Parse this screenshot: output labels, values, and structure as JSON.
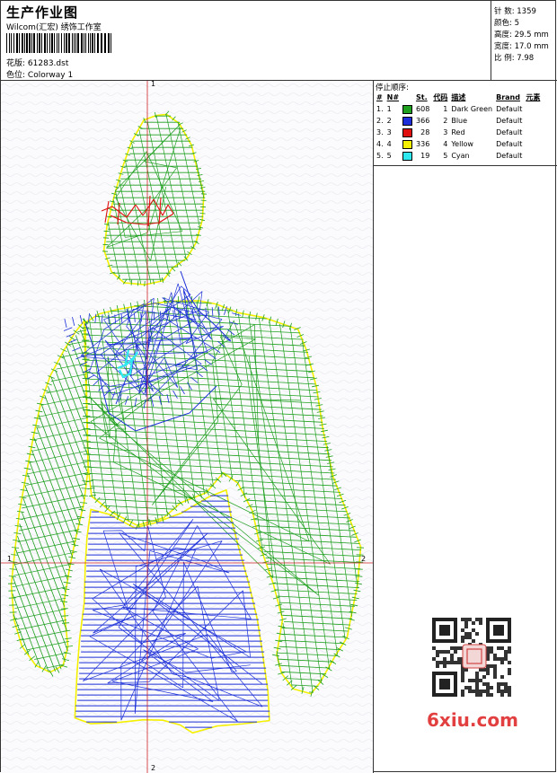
{
  "header": {
    "title": "生产作业图",
    "company": "Wilcom(汇宏) 绣饰工作室",
    "design_label": "花版:",
    "design_file": "61283.dst",
    "colorway_label": "色位:",
    "colorway": "Colorway 1"
  },
  "stats": {
    "stitches": "针 数: 1359",
    "colors": "颜色: 5",
    "height": "高度: 29.5 mm",
    "width": "宽度: 17.0 mm",
    "ratio": "比 例: 7.98"
  },
  "stop_sequence": {
    "title": "停止顺序:",
    "headers": [
      "#",
      "N#",
      "St.",
      "代码",
      "描述",
      "Brand",
      "元素"
    ],
    "rows": [
      {
        "idx": "1.",
        "n": "1",
        "color": "#1fa01f",
        "st": "608",
        "code": "1",
        "desc": "Dark Green",
        "brand": "Default"
      },
      {
        "idx": "2.",
        "n": "2",
        "color": "#1c2fd8",
        "st": "366",
        "code": "2",
        "desc": "Blue",
        "brand": "Default"
      },
      {
        "idx": "3.",
        "n": "3",
        "color": "#e01010",
        "st": "28",
        "code": "3",
        "desc": "Red",
        "brand": "Default"
      },
      {
        "idx": "4.",
        "n": "4",
        "color": "#f4f000",
        "st": "336",
        "code": "4",
        "desc": "Yellow",
        "brand": "Default"
      },
      {
        "idx": "5.",
        "n": "5",
        "color": "#30e8f0",
        "st": "19",
        "code": "5",
        "desc": "Cyan",
        "brand": "Default"
      }
    ]
  },
  "axes": {
    "top": "1",
    "bottom": "2",
    "left": "1",
    "right": "2"
  },
  "watermark": "6xiu.com",
  "colors": {
    "green": "#1fa01f",
    "blue": "#1c2fd8",
    "red": "#e01010",
    "yellow": "#f4f000",
    "cyan": "#30e8f0",
    "axis": "#cc2222"
  }
}
